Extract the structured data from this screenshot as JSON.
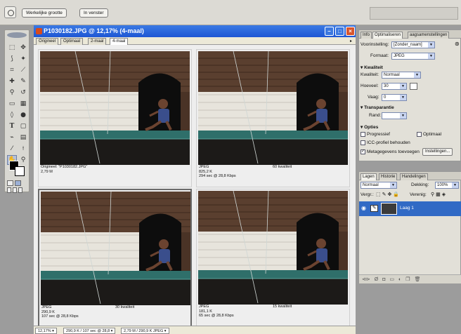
{
  "options_bar": {
    "actual_pixels_label": "Werkelijke grootte",
    "fit_window_label": "In venster"
  },
  "document": {
    "title": "P1030182.JPG @ 12,17% (4-maal)",
    "tabs": [
      "Origineel",
      "Optimaal",
      "2-maal",
      "4-maal"
    ],
    "active_tab": 3,
    "status": {
      "zoom": "12,17%",
      "info1": "290,9 K / 107 sec @ 28,8",
      "info2": "2,79 M / 290,9 K JPEG"
    },
    "panes": [
      {
        "line1": "Origineel: \"P1030182.JPG\"",
        "line2": "2,79 M",
        "line3": "",
        "quality": ""
      },
      {
        "line1": "JPEG",
        "line2": "825,2 K",
        "line3": "294 sec @ 28,8 Kbps",
        "quality": "60 kwaliteit"
      },
      {
        "line1": "JPEG",
        "line2": "290,9 K",
        "line3": "107 sec @ 28,8 Kbps",
        "quality": "30 kwaliteit"
      },
      {
        "line1": "JPEG",
        "line2": "181,1 K",
        "line3": "65 sec @ 28,8 Kbps",
        "quality": "15 kwaliteit"
      }
    ],
    "selected_pane": 2
  },
  "optimize_panel": {
    "tabs": [
      "Info",
      "Optimaliseren",
      "aagsamenstellingen"
    ],
    "active_tab": 1,
    "preset_label": "Voorinstelling:",
    "preset_value": "[Zonder_naam]",
    "format_label": "Formaat:",
    "format_value": "JPEG",
    "quality_section": "Kwaliteit",
    "quality_label": "Kwaliteit:",
    "quality_value": "Normaal",
    "amount_label": "Hoeveel:",
    "amount_value": "30",
    "blur_label": "Vaag:",
    "blur_value": "0",
    "transparency_section": "Transparantie",
    "matte_label": "Rand:",
    "options_section": "Opties",
    "progressive_label": "Progressief",
    "optimized_label": "Optimaal",
    "icc_label": "ICC-profiel behouden",
    "metadata_label": "Metagegevens toevoegen",
    "settings_button": "Instellingen..."
  },
  "layers_panel": {
    "tabs": [
      "Lagen",
      "Historie",
      "Handelingen"
    ],
    "active_tab": 0,
    "blend_mode": "Normaal",
    "opacity_label": "Dekking:",
    "opacity_value": "100%",
    "lock_label": "Vergr.:",
    "unify_label": "Verenig:",
    "layer_name": "Laag 1"
  }
}
